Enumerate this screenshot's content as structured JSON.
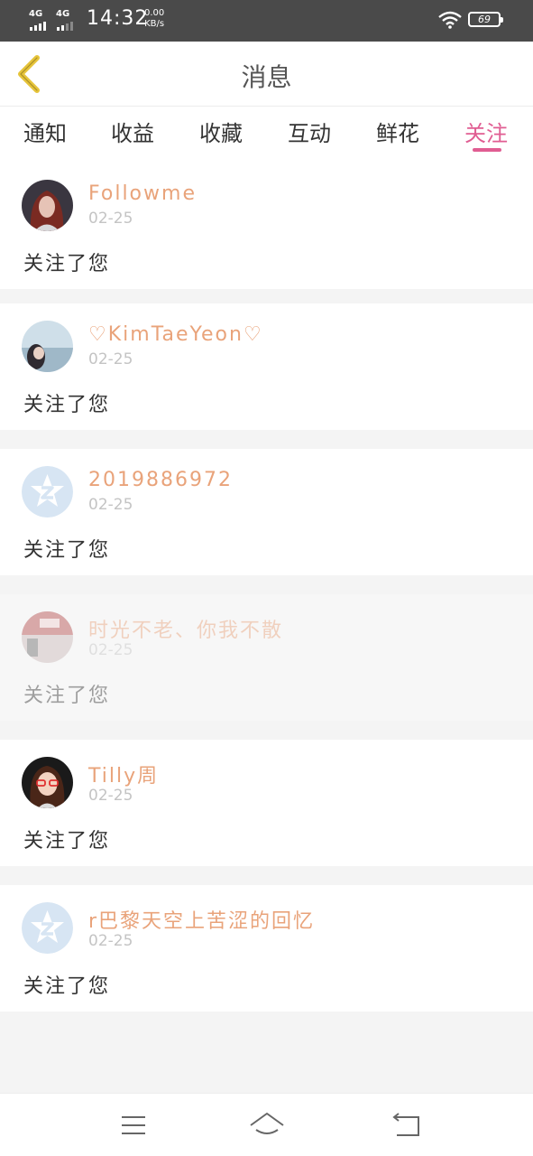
{
  "status_bar": {
    "net1": "4G",
    "net2": "4G",
    "time": "14:32",
    "speed_value": "0.00",
    "speed_unit": "KB/s",
    "battery": "69"
  },
  "header": {
    "title": "消息"
  },
  "tabs": [
    {
      "label": "通知",
      "active": false
    },
    {
      "label": "收益",
      "active": false
    },
    {
      "label": "收藏",
      "active": false
    },
    {
      "label": "互动",
      "active": false
    },
    {
      "label": "鲜花",
      "active": false
    },
    {
      "label": "关注",
      "active": true
    }
  ],
  "notifications": [
    {
      "name": "Followme",
      "date": "02-25",
      "message": "关注了您",
      "avatar": "photo-red-hair"
    },
    {
      "name": "♡KimTaeYeon♡",
      "date": "02-25",
      "message": "关注了您",
      "avatar": "photo-sky"
    },
    {
      "name": "2019886972",
      "date": "02-25",
      "message": "关注了您",
      "avatar": "default-qzone"
    },
    {
      "name": "时光不老、你我不散",
      "date": "02-25",
      "message": "关注了您",
      "avatar": "photo-street"
    },
    {
      "name": "Tilly周",
      "date": "02-25",
      "message": "关注了您",
      "avatar": "cartoon-girl"
    },
    {
      "name": "r巴黎天空上苦涩的回忆",
      "date": "02-25",
      "message": "关注了您",
      "avatar": "default-qzone"
    }
  ],
  "colors": {
    "accent": "#e05d92",
    "name": "#e9a37a",
    "back_arrow": "#e6c43a"
  }
}
